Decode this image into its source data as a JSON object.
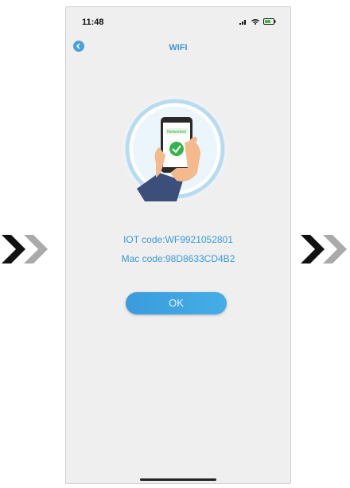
{
  "status_bar": {
    "time": "11:48"
  },
  "nav": {
    "title": "WIFI"
  },
  "illustration": {
    "phone_label": "Networked"
  },
  "info": {
    "iot_code": "IOT code:WF9921052801",
    "mac_code": "Mac code:98D8633CD4B2"
  },
  "ok_button": {
    "label": "OK"
  },
  "colors": {
    "accent": "#3e97d3",
    "background": "#efefef"
  },
  "icons": [
    "chevron-right-double-icon",
    "signal-icon",
    "wifi-icon",
    "battery-icon",
    "back-arrow-icon"
  ]
}
